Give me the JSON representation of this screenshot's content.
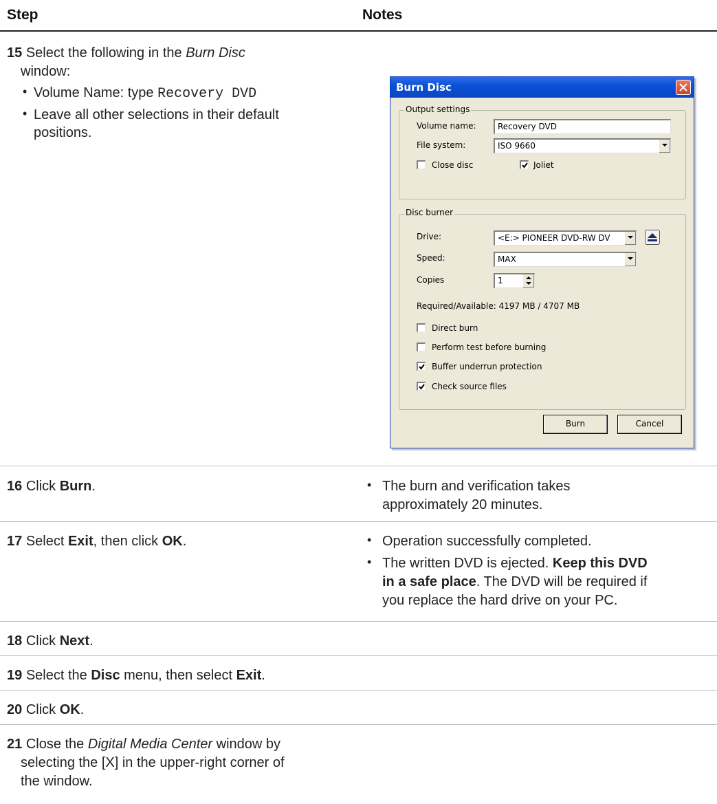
{
  "header": {
    "step": "Step",
    "notes": "Notes"
  },
  "step15": {
    "num": "15",
    "line1_pre": "Select the following in the ",
    "line1_em": "Burn Disc",
    "line2": "window:",
    "bullet1_pre": "Volume Name: type ",
    "bullet1_code": "Recovery DVD",
    "bullet2_l1": "Leave all other selections in their default",
    "bullet2_l2": "positions."
  },
  "dialog": {
    "title": "Burn Disc",
    "output_group": "Output settings",
    "volume_label": "Volume name:",
    "volume_value": "Recovery DVD",
    "filesystem_label": "File system:",
    "filesystem_value": "ISO 9660",
    "close_disc_label": "Close disc",
    "close_disc_checked": false,
    "joliet_label": "Joliet",
    "joliet_checked": true,
    "burner_group": "Disc burner",
    "drive_label": "Drive:",
    "drive_value": "<E:> PIONEER DVD-RW DV",
    "speed_label": "Speed:",
    "speed_value": "MAX",
    "copies_label": "Copies",
    "copies_value": "1",
    "required_text": "Required/Available: 4197 MB / 4707 MB",
    "direct_burn_label": "Direct burn",
    "test_label": "Perform test before burning",
    "buffer_label": "Buffer underrun protection",
    "check_label": "Check source files",
    "burn_button": "Burn",
    "cancel_button": "Cancel"
  },
  "step16": {
    "num": "16",
    "text_pre": "Click ",
    "text_bold": "Burn",
    "text_post": ".",
    "note_l1": "The burn and verification takes",
    "note_l2": "approximately 20 minutes."
  },
  "step17": {
    "num": "17",
    "t1": "Select ",
    "b1": "Exit",
    "t2": ", then click ",
    "b2": "OK",
    "t3": ".",
    "note1": "Operation successfully completed.",
    "note2_l1_pre": "The written DVD is ejected. ",
    "note2_l1_bold": "Keep this DVD",
    "note2_l2_bold": "in a safe place",
    "note2_l2_post": ". The DVD will be required if",
    "note2_l3": "you replace the hard drive on your PC."
  },
  "step18": {
    "num": "18",
    "t1": "Click ",
    "b1": "Next",
    "t2": "."
  },
  "step19": {
    "num": "19",
    "t1": "Select the ",
    "b1": "Disc",
    "t2": " menu, then select ",
    "b2": "Exit",
    "t3": "."
  },
  "step20": {
    "num": "20",
    "t1": "Click ",
    "b1": "OK",
    "t2": "."
  },
  "step21": {
    "num": "21",
    "l1_pre": "Close the ",
    "l1_em": "Digital Media Center",
    "l1_post": " window by",
    "l2": "selecting the [X] in the upper-right corner of",
    "l3": "the window."
  }
}
